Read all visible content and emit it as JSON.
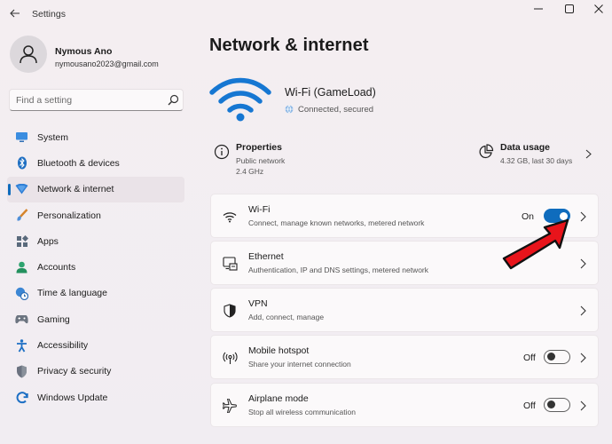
{
  "window": {
    "app_title": "Settings"
  },
  "user": {
    "name": "Nymous Ano",
    "email": "nymousano2023@gmail.com"
  },
  "search": {
    "placeholder": "Find a setting"
  },
  "sidebar": {
    "items": [
      {
        "label": "System",
        "icon": "monitor-icon"
      },
      {
        "label": "Bluetooth & devices",
        "icon": "bluetooth-icon"
      },
      {
        "label": "Network & internet",
        "icon": "network-icon",
        "active": true
      },
      {
        "label": "Personalization",
        "icon": "brush-icon"
      },
      {
        "label": "Apps",
        "icon": "apps-icon"
      },
      {
        "label": "Accounts",
        "icon": "person-icon"
      },
      {
        "label": "Time & language",
        "icon": "globe-clock-icon"
      },
      {
        "label": "Gaming",
        "icon": "gamepad-icon"
      },
      {
        "label": "Accessibility",
        "icon": "accessibility-icon"
      },
      {
        "label": "Privacy & security",
        "icon": "shield-icon"
      },
      {
        "label": "Windows Update",
        "icon": "update-icon"
      }
    ]
  },
  "main": {
    "title": "Network & internet",
    "network": {
      "name": "Wi-Fi (GameLoad)",
      "status": "Connected, secured"
    },
    "properties": {
      "title": "Properties",
      "line1": "Public network",
      "line2": "2.4 GHz"
    },
    "data_usage": {
      "title": "Data usage",
      "detail": "4.32 GB, last 30 days"
    },
    "cards": [
      {
        "title": "Wi-Fi",
        "subtitle": "Connect, manage known networks, metered network",
        "toggle": "On",
        "toggle_on": true
      },
      {
        "title": "Ethernet",
        "subtitle": "Authentication, IP and DNS settings, metered network"
      },
      {
        "title": "VPN",
        "subtitle": "Add, connect, manage"
      },
      {
        "title": "Mobile hotspot",
        "subtitle": "Share your internet connection",
        "toggle": "Off",
        "toggle_on": false
      },
      {
        "title": "Airplane mode",
        "subtitle": "Stop all wireless communication",
        "toggle": "Off",
        "toggle_on": false
      }
    ]
  },
  "colors": {
    "accent": "#0f6cbd",
    "annotation_arrow": "#e8141b"
  }
}
